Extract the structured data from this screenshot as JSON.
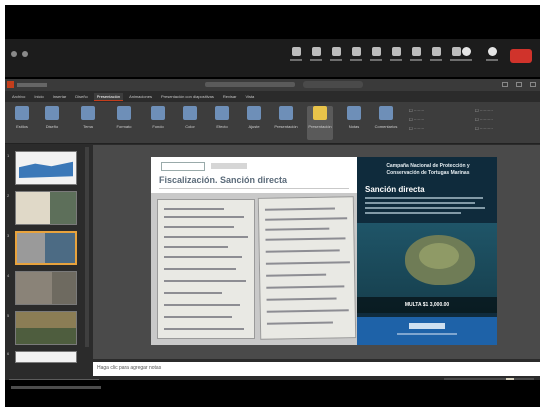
{
  "app": {
    "name": "PowerPoint",
    "active_tab": "Presentación"
  },
  "ribbon": {
    "tabs": [
      "Archivo",
      "Inicio",
      "Insertar",
      "Diseño",
      "Presentación",
      "Animaciones",
      "Presentación con diapositivas",
      "Revisar",
      "Vista"
    ],
    "buttons": [
      "Estilos",
      "Diseño",
      "Tema",
      "Formato",
      "Fondo",
      "Color",
      "Efecto",
      "Ajuste",
      "Presentación",
      "Notas",
      "Comentarios"
    ],
    "selected_button_index": 8
  },
  "thumbnails": {
    "count": 6,
    "selected_index": 2,
    "numbers": [
      "1",
      "2",
      "3",
      "4",
      "5",
      "6"
    ]
  },
  "slide": {
    "title": "Fiscalización. Sanción directa",
    "poster": {
      "heading": "Campaña Nacional de Protección y Conservación de Tortugas Marinas",
      "subheading": "Sanción directa",
      "fine": "MULTA $1 3,000.00"
    }
  },
  "notes": {
    "placeholder": "Haga clic para agregar notas"
  }
}
